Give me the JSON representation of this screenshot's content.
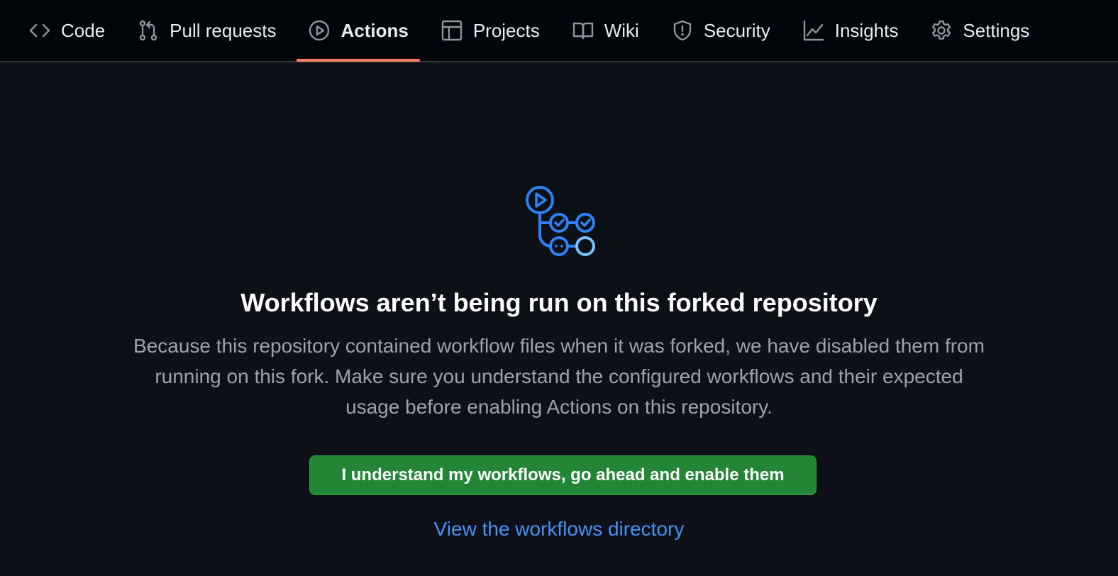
{
  "nav": {
    "tabs": [
      {
        "label": "Code",
        "icon": "code-icon",
        "active": false
      },
      {
        "label": "Pull requests",
        "icon": "git-pull-request-icon",
        "active": false
      },
      {
        "label": "Actions",
        "icon": "play-circle-icon",
        "active": true
      },
      {
        "label": "Projects",
        "icon": "table-icon",
        "active": false
      },
      {
        "label": "Wiki",
        "icon": "book-icon",
        "active": false
      },
      {
        "label": "Security",
        "icon": "shield-icon",
        "active": false
      },
      {
        "label": "Insights",
        "icon": "graph-icon",
        "active": false
      },
      {
        "label": "Settings",
        "icon": "gear-icon",
        "active": false
      }
    ],
    "active_underline_color": "#f78166"
  },
  "main": {
    "icon": "workflow-icon",
    "title": "Workflows aren’t being run on this forked repository",
    "description": "Because this repository contained workflow files when it was forked, we have disabled them from running on this fork. Make sure you understand the configured workflows and their expected usage before enabling Actions on this repository.",
    "enable_button_label": "I understand my workflows, go ahead and enable them",
    "directory_link_label": "View the workflows directory"
  },
  "colors": {
    "background": "#0d1117",
    "nav_background": "#010409",
    "accent_blue": "#4493f8",
    "button_green": "#238636"
  }
}
